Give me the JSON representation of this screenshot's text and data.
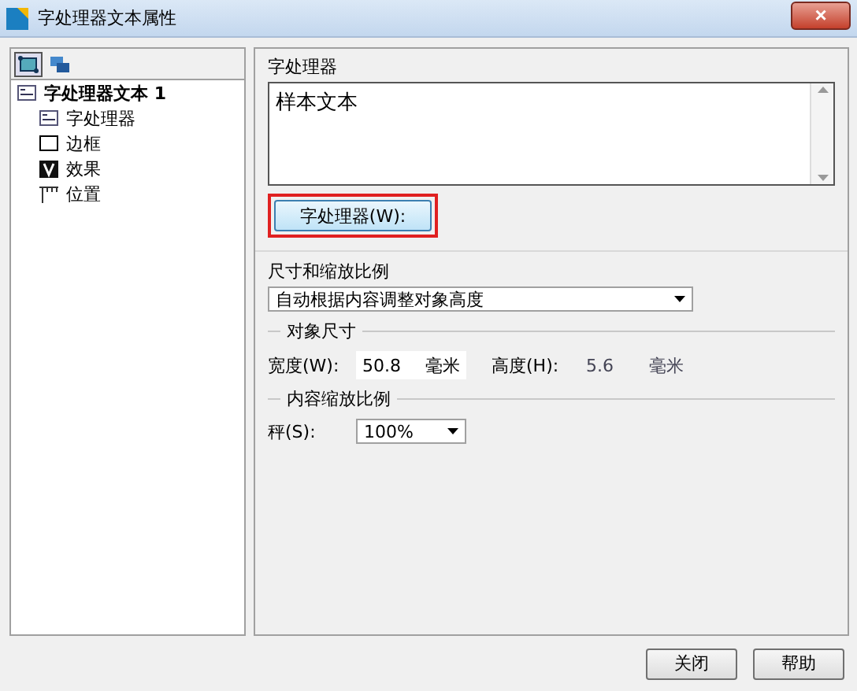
{
  "window": {
    "title": "字处理器文本属性",
    "close": "×"
  },
  "tree": {
    "label": "字处理器文本 1",
    "children": [
      {
        "label": "字处理器",
        "kind": "text"
      },
      {
        "label": "边框",
        "kind": "border"
      },
      {
        "label": "效果",
        "kind": "effect"
      },
      {
        "label": "位置",
        "kind": "position"
      }
    ]
  },
  "text_group": {
    "title": "字处理器",
    "value": "样本文本",
    "button": {
      "label": "字处理器(W):",
      "highlighted": true
    }
  },
  "size_group": {
    "title": "尺寸和缩放比例",
    "mode": "自动根据内容调整对象高度",
    "object_size": {
      "title": "对象尺寸",
      "fields": [
        {
          "label": "宽度(W):",
          "value": "50.8",
          "unit": "毫米",
          "disabled": false
        },
        {
          "label": "高度(H):",
          "value": "5.6",
          "unit": "毫米",
          "disabled": true
        }
      ]
    },
    "scale": {
      "title": "内容缩放比例",
      "label": "秤(S):",
      "value": "100%"
    }
  },
  "buttons": [
    "关闭",
    "帮助"
  ]
}
